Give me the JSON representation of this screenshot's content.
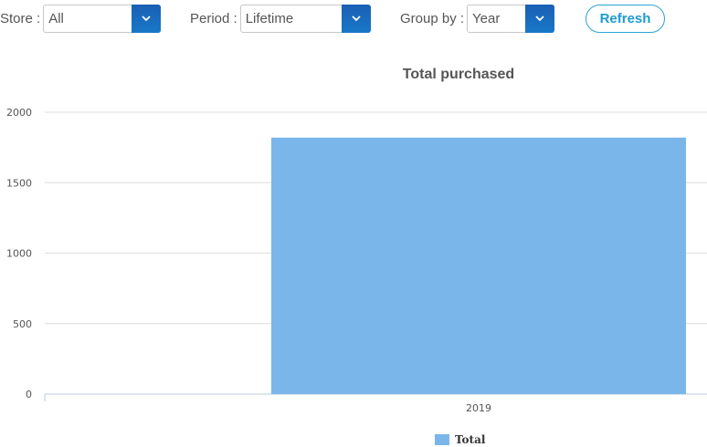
{
  "filters": {
    "store": {
      "label": "Store :",
      "value": "All"
    },
    "period": {
      "label": "Period :",
      "value": "Lifetime"
    },
    "group_by": {
      "label": "Group by :",
      "value": "Year"
    }
  },
  "refresh_label": "Refresh",
  "icons": {
    "dropdown": "chevron-down-icon"
  },
  "colors": {
    "bar": "#7ab6ea",
    "accent": "#1e9ad0",
    "select_button": "#1a6bbd"
  },
  "chart_data": {
    "type": "bar",
    "title": "Total purchased",
    "categories": [
      "2019"
    ],
    "series": [
      {
        "name": "Total",
        "values": [
          1820
        ]
      }
    ],
    "ylim": [
      0,
      2000
    ],
    "yticks": [
      0,
      500,
      1000,
      1500,
      2000
    ],
    "grid": true,
    "legend": "bottom"
  }
}
